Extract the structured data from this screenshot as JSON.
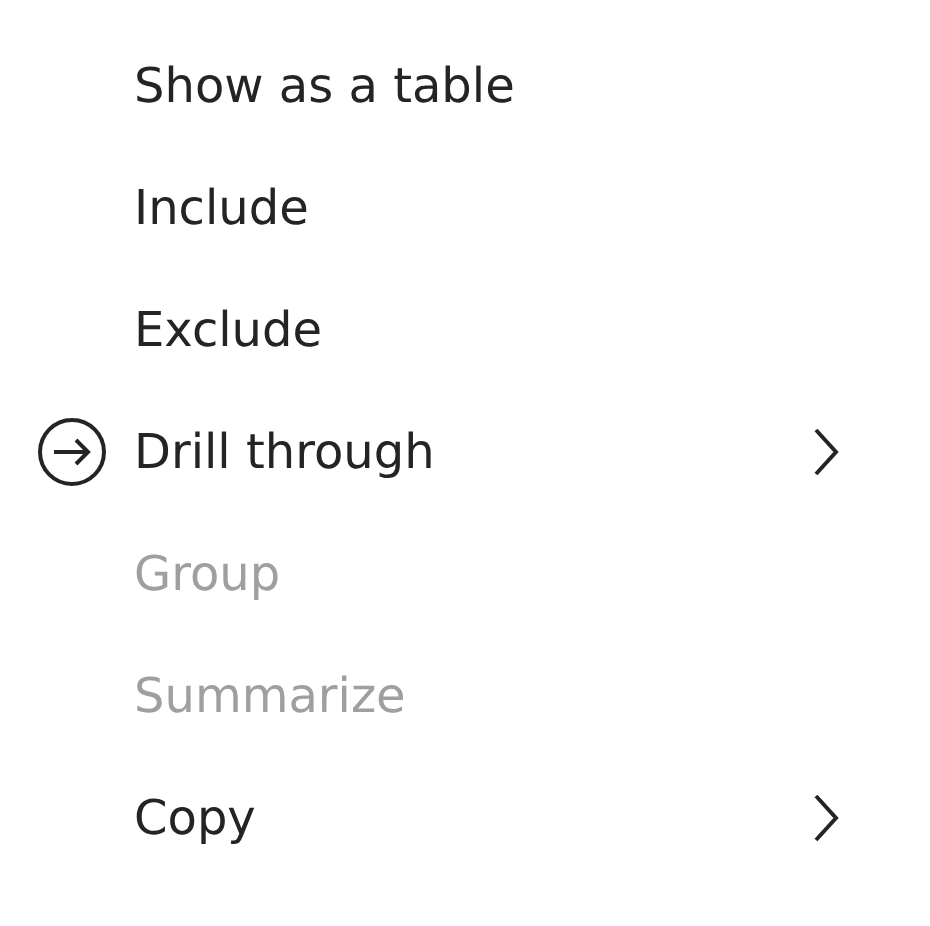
{
  "menu": {
    "items": [
      {
        "label": "Show as a table",
        "disabled": false,
        "has_icon": false,
        "submenu": false
      },
      {
        "label": "Include",
        "disabled": false,
        "has_icon": false,
        "submenu": false
      },
      {
        "label": "Exclude",
        "disabled": false,
        "has_icon": false,
        "submenu": false
      },
      {
        "label": "Drill through",
        "disabled": false,
        "has_icon": true,
        "submenu": true
      },
      {
        "label": "Group",
        "disabled": true,
        "has_icon": false,
        "submenu": false
      },
      {
        "label": "Summarize",
        "disabled": true,
        "has_icon": false,
        "submenu": false
      },
      {
        "label": "Copy",
        "disabled": false,
        "has_icon": false,
        "submenu": true
      }
    ]
  }
}
